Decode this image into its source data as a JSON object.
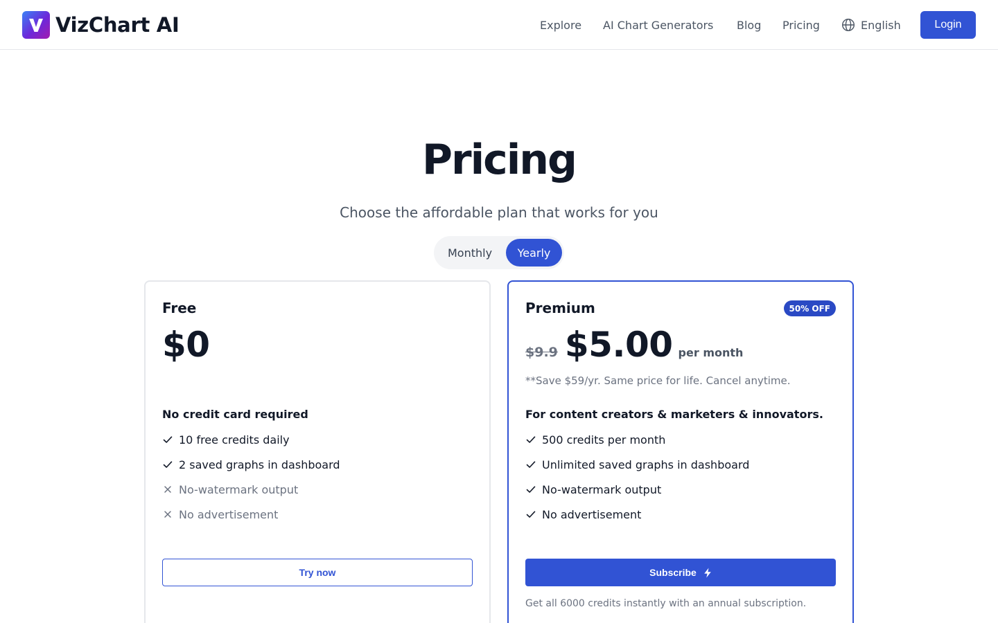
{
  "header": {
    "logo_text": "VizChart AI",
    "nav": {
      "explore": "Explore",
      "generators": "AI Chart Generators",
      "blog": "Blog",
      "pricing": "Pricing",
      "language": "English"
    },
    "login_label": "Login"
  },
  "hero": {
    "title": "Pricing",
    "subtitle": "Choose the affordable plan that works for you"
  },
  "billing_toggle": {
    "monthly": "Monthly",
    "yearly": "Yearly",
    "selected": "Yearly"
  },
  "plans": {
    "free": {
      "name": "Free",
      "price": "$0",
      "features_heading": "No credit card required",
      "features": [
        {
          "text": "10 free credits daily",
          "included": true
        },
        {
          "text": "2 saved graphs in dashboard",
          "included": true
        },
        {
          "text": "No-watermark output",
          "included": false
        },
        {
          "text": "No advertisement",
          "included": false
        }
      ],
      "cta": "Try now"
    },
    "premium": {
      "name": "Premium",
      "badge": "50% OFF",
      "old_price": "$9.9",
      "price": "$5.00",
      "period": "per month",
      "note": "**Save $59/yr. Same price for life. Cancel anytime.",
      "features_heading": "For content creators & marketers & innovators.",
      "features": [
        {
          "text": "500 credits per month",
          "included": true
        },
        {
          "text": "Unlimited saved graphs in dashboard",
          "included": true
        },
        {
          "text": "No-watermark output",
          "included": true
        },
        {
          "text": "No advertisement",
          "included": true
        }
      ],
      "cta": "Subscribe",
      "annual_note": "Get all 6000 credits instantly with an annual subscription."
    }
  },
  "colors": {
    "accent": "#3153d4",
    "badge": "#2a49c4",
    "text_primary": "#111827",
    "text_muted": "#6b7280",
    "card_border": "#e5e7eb"
  },
  "icons": {
    "logo": "v-logo-icon",
    "language": "globe-icon",
    "included": "check-icon",
    "excluded": "x-icon",
    "subscribe": "lightning-bolt-icon"
  }
}
